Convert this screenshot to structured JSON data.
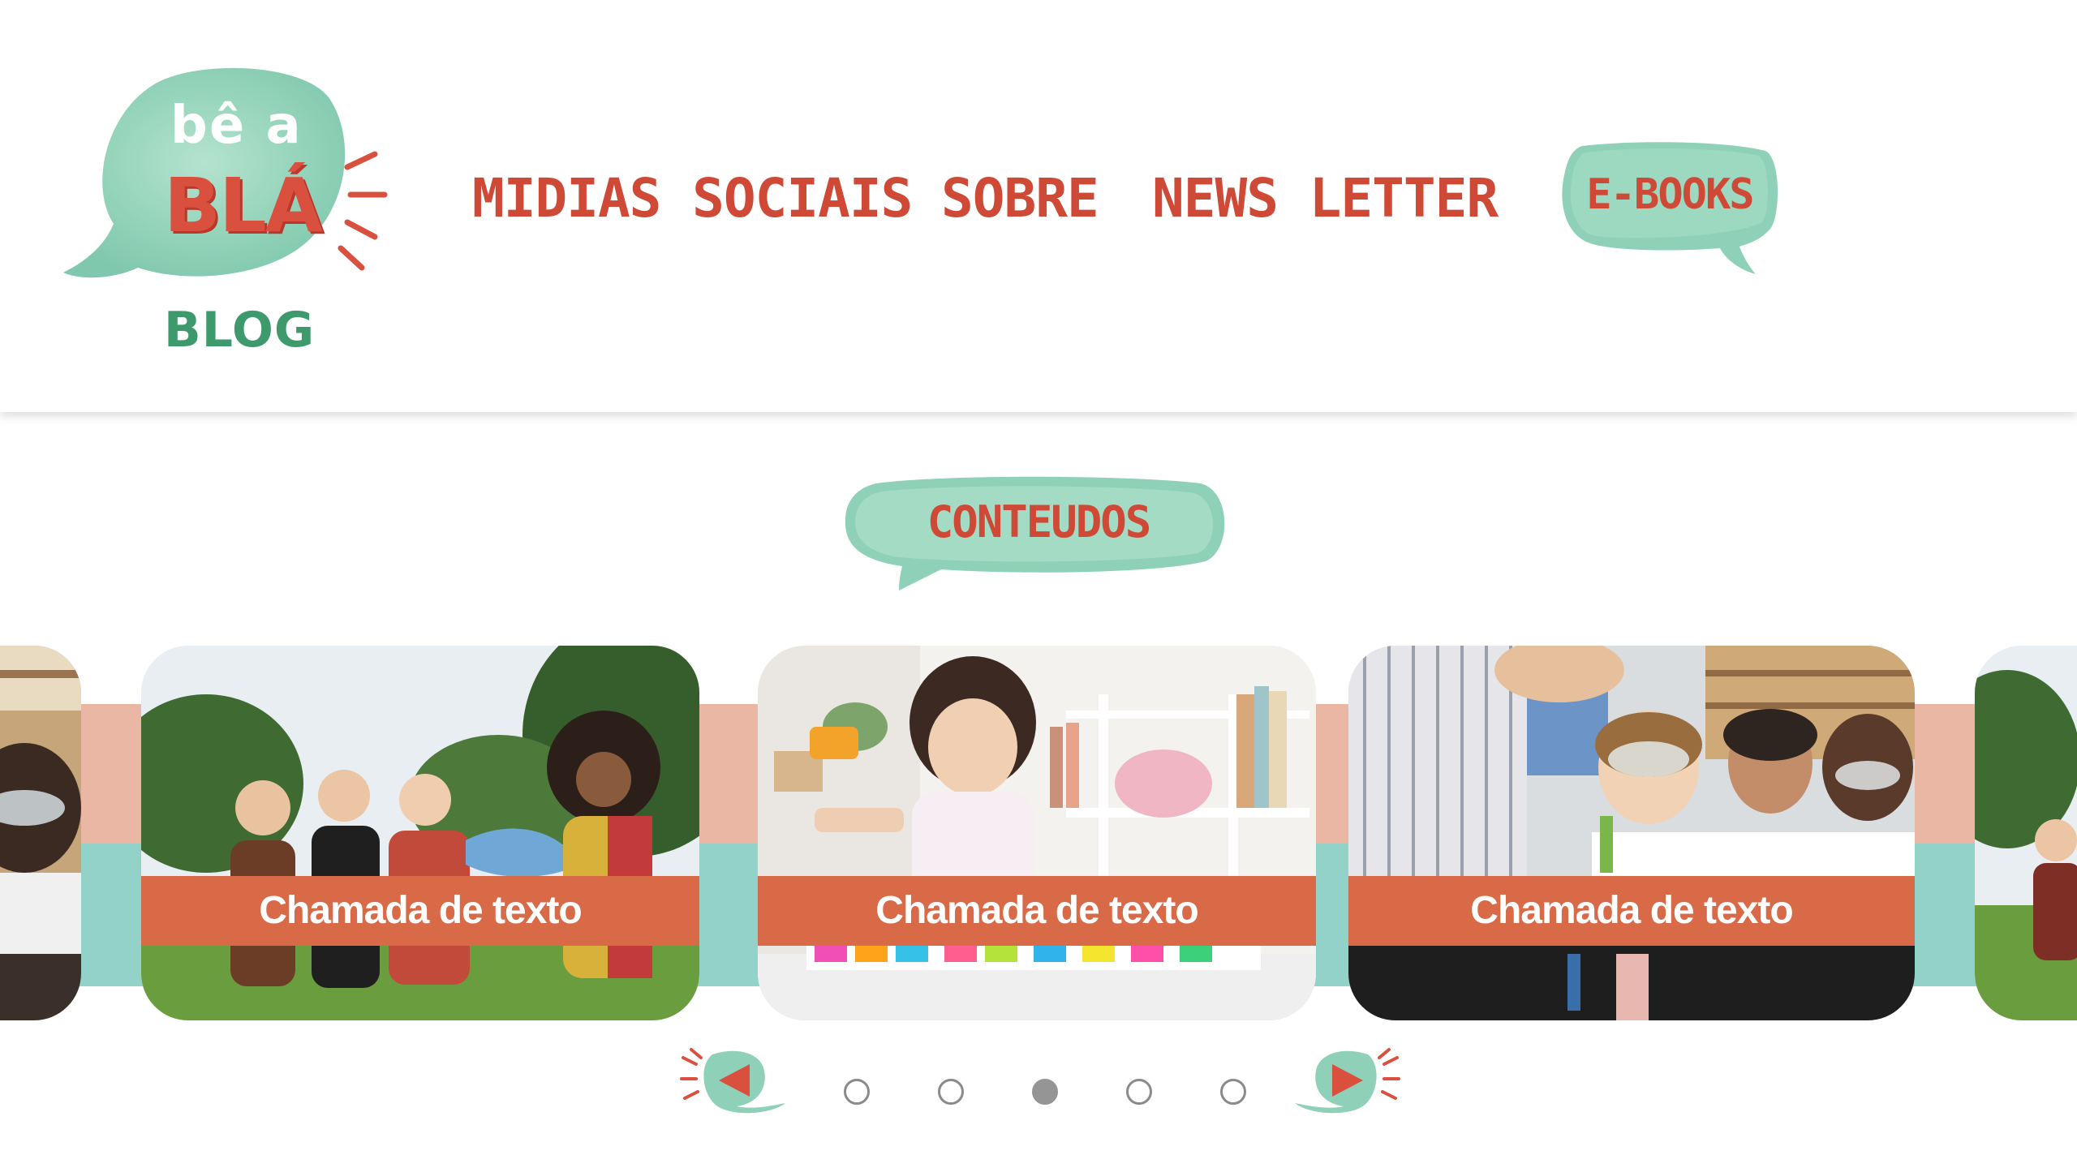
{
  "logo": {
    "line1": "bê a",
    "line2": "BLÁ",
    "subtitle": "BLOG"
  },
  "nav": {
    "items": [
      "MIDIAS SOCIAIS",
      "SOBRE",
      "NEWS LETTER"
    ],
    "ebooks": "E-BOOKS"
  },
  "section": {
    "title": "CONTEUDOS"
  },
  "carousel": {
    "cards": [
      {
        "caption": "Chamada de texto",
        "image": "children running in costumes"
      },
      {
        "caption": "Chamada de texto",
        "image": "girl playing with toy blocks"
      },
      {
        "caption": "Chamada de texto",
        "image": "children in science class"
      }
    ],
    "dots": 5,
    "active_dot": 3
  },
  "colors": {
    "accent_red": "#cf4937",
    "mint": "#8fd1b8",
    "caption_orange": "#d86a48",
    "stripe_pink": "#ebb7a5",
    "stripe_teal": "#93d2c8",
    "logo_green": "#3e9a6c"
  },
  "icons": {
    "prev": "triangle-left-icon",
    "next": "triangle-right-icon"
  }
}
